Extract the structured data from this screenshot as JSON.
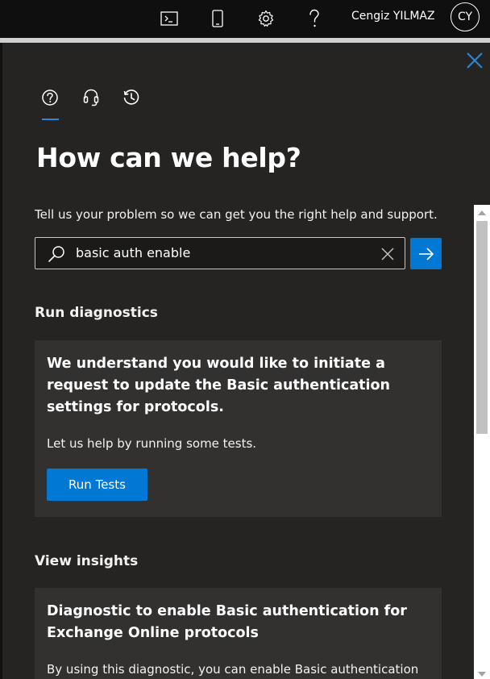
{
  "topbar": {
    "icons": [
      "terminal-icon",
      "mobile-icon",
      "gear-icon",
      "question-icon"
    ],
    "user_name": "Cengiz YILMAZ",
    "avatar_initials": "CY"
  },
  "panel": {
    "tabs": [
      {
        "icon": "help-circle-icon",
        "selected": true
      },
      {
        "icon": "headset-icon",
        "selected": false
      },
      {
        "icon": "history-icon",
        "selected": false
      }
    ],
    "heading": "How can we help?",
    "intro": "Tell us your problem so we can get you the right help and support.",
    "search": {
      "value": "basic auth enable"
    },
    "diagnostics": {
      "section_title": "Run diagnostics",
      "card_title": "We understand you would like to initiate a request to update the Basic authentication settings for protocols.",
      "card_body": "Let us help by running some tests.",
      "button_label": "Run Tests"
    },
    "insights": {
      "section_title": "View insights",
      "card_title": "Diagnostic to enable Basic authentication for Exchange Online protocols",
      "card_body": "By using this diagnostic, you can enable Basic authentication"
    }
  },
  "colors": {
    "accent": "#0078d4",
    "panel_bg": "#252423",
    "card_bg": "#323130",
    "topbar_bg": "#0f0f0f"
  }
}
